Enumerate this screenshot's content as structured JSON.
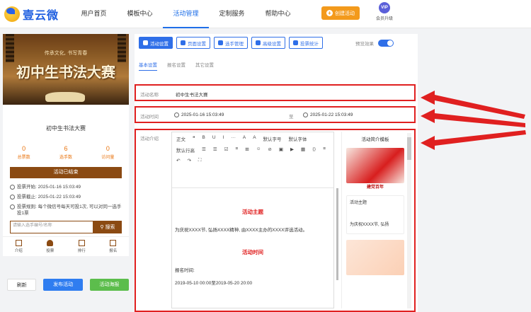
{
  "app": {
    "name": "壹云微"
  },
  "nav": {
    "items": [
      "用户首页",
      "模板中心",
      "活动管理",
      "定制服务",
      "帮助中心"
    ]
  },
  "header": {
    "create_label": "创建活动",
    "vip_badge": "VIP",
    "vip_label": "会员升级"
  },
  "poster": {
    "subtitle": "传承文化, 书写青春",
    "title": "初中生书法大赛"
  },
  "card": {
    "title": "初中生书法大赛",
    "stats": [
      {
        "value": "0",
        "label": "总票数"
      },
      {
        "value": "6",
        "label": "选手数"
      },
      {
        "value": "0",
        "label": "访问量"
      }
    ],
    "status": "活动已结束",
    "info": [
      "投票开始: 2025-01-16 15:03:49",
      "投票截止: 2025-01-22 15:03:49",
      "投票规则: 每个微信号每天可投1次, 可以对同一选手投1票"
    ],
    "search_placeholder": "请输入选手编号/名称",
    "search_label": "搜索",
    "tabs": [
      "介绍",
      "投票",
      "排行",
      "报名"
    ]
  },
  "actions": {
    "refresh": "刷新",
    "publish": "发布活动",
    "poster": "活动海报"
  },
  "toolbar": {
    "buttons": [
      "活动设置",
      "页面设置",
      "选手管理",
      "高级设置",
      "投票统计"
    ],
    "preview_label": "预览效果"
  },
  "subtabs": [
    "基本设置",
    "报名设置",
    "其它设置"
  ],
  "form": {
    "name_label": "活动名称",
    "name_value": "初中生书法大赛",
    "time_label": "活动时间",
    "time_start": "2025-01-16 15:03:49",
    "time_sep": "至",
    "time_end": "2025-01-22 15:03:49",
    "intro_label": "活动介绍"
  },
  "editor": {
    "tools": [
      "正文",
      "❝",
      "B",
      "U",
      "I",
      "···",
      "A",
      "A",
      "默认字号",
      "默认字体",
      "默认行高",
      "☰",
      "☰",
      "☑",
      "≡",
      "⊞",
      "☺",
      "⊘",
      "▣",
      "▶",
      "▦",
      "⟨⟩",
      "≡",
      "↶",
      "↷",
      "⛶"
    ],
    "heading1": "活动主题",
    "paragraph1": "为庆祝XXXX节, 弘扬XXXX精神, 由XXXX主办的XXXX评选活动。",
    "heading2": "活动时间",
    "paragraph2": "报名时间:",
    "paragraph3": "2019-05-10 00:00至2019-05-20 20:00"
  },
  "templates": {
    "title": "活动简介模板",
    "card1_caption": "建党百年",
    "card2_title": "活动主题",
    "card2_text": "为庆祝XXXX节, 弘扬"
  }
}
